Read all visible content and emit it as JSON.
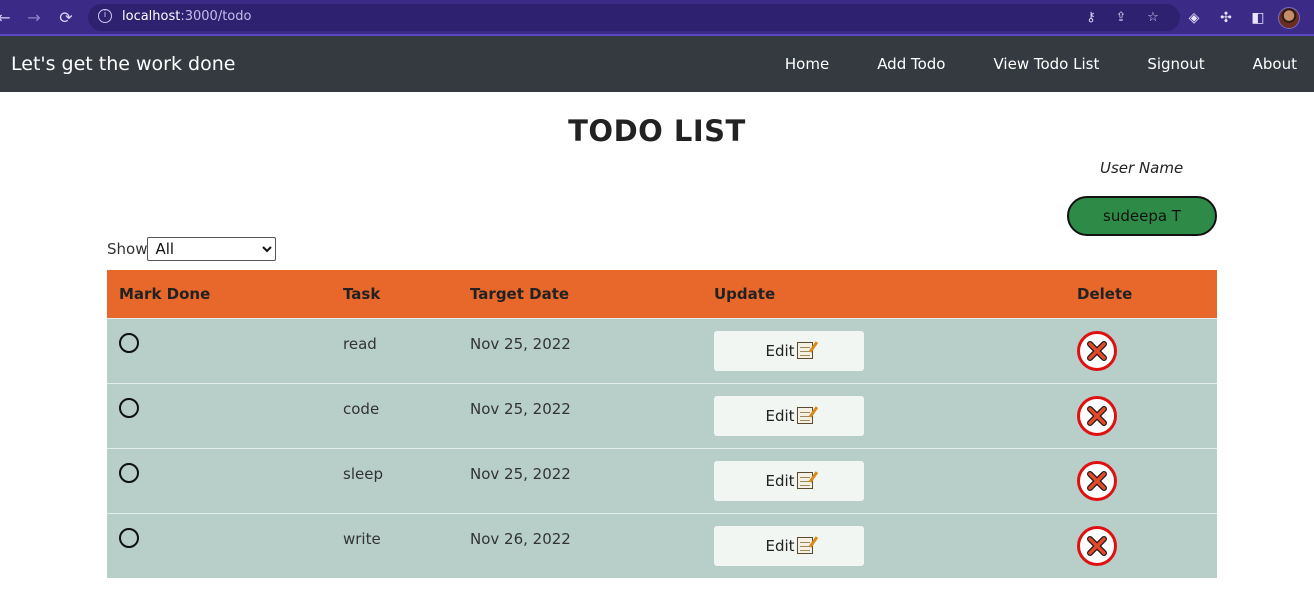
{
  "browser": {
    "url_host": "localhost",
    "url_path": ":3000/todo"
  },
  "navbar": {
    "brand": "Let's get the work done",
    "links": [
      "Home",
      "Add Todo",
      "View Todo List",
      "Signout",
      "About"
    ]
  },
  "page": {
    "title": "TODO LIST",
    "user_label": "User Name",
    "user_name": "sudeepa T"
  },
  "filter": {
    "label": "Show",
    "selected": "All"
  },
  "table": {
    "headers": [
      "Mark Done",
      "Task",
      "Target Date",
      "Update",
      "Delete"
    ],
    "rows": [
      {
        "task": "read",
        "date": "Nov 25, 2022",
        "edit_label": "Edit"
      },
      {
        "task": "code",
        "date": "Nov 25, 2022",
        "edit_label": "Edit"
      },
      {
        "task": "sleep",
        "date": "Nov 25, 2022",
        "edit_label": "Edit"
      },
      {
        "task": "write",
        "date": "Nov 26, 2022",
        "edit_label": "Edit"
      }
    ]
  },
  "colors": {
    "browser_bar": "#3b2a86",
    "navbar": "#343a40",
    "table_header": "#e8672a",
    "table_row": "#b7cec9",
    "user_badge": "#2e8b47",
    "delete_ring": "#e01010"
  }
}
